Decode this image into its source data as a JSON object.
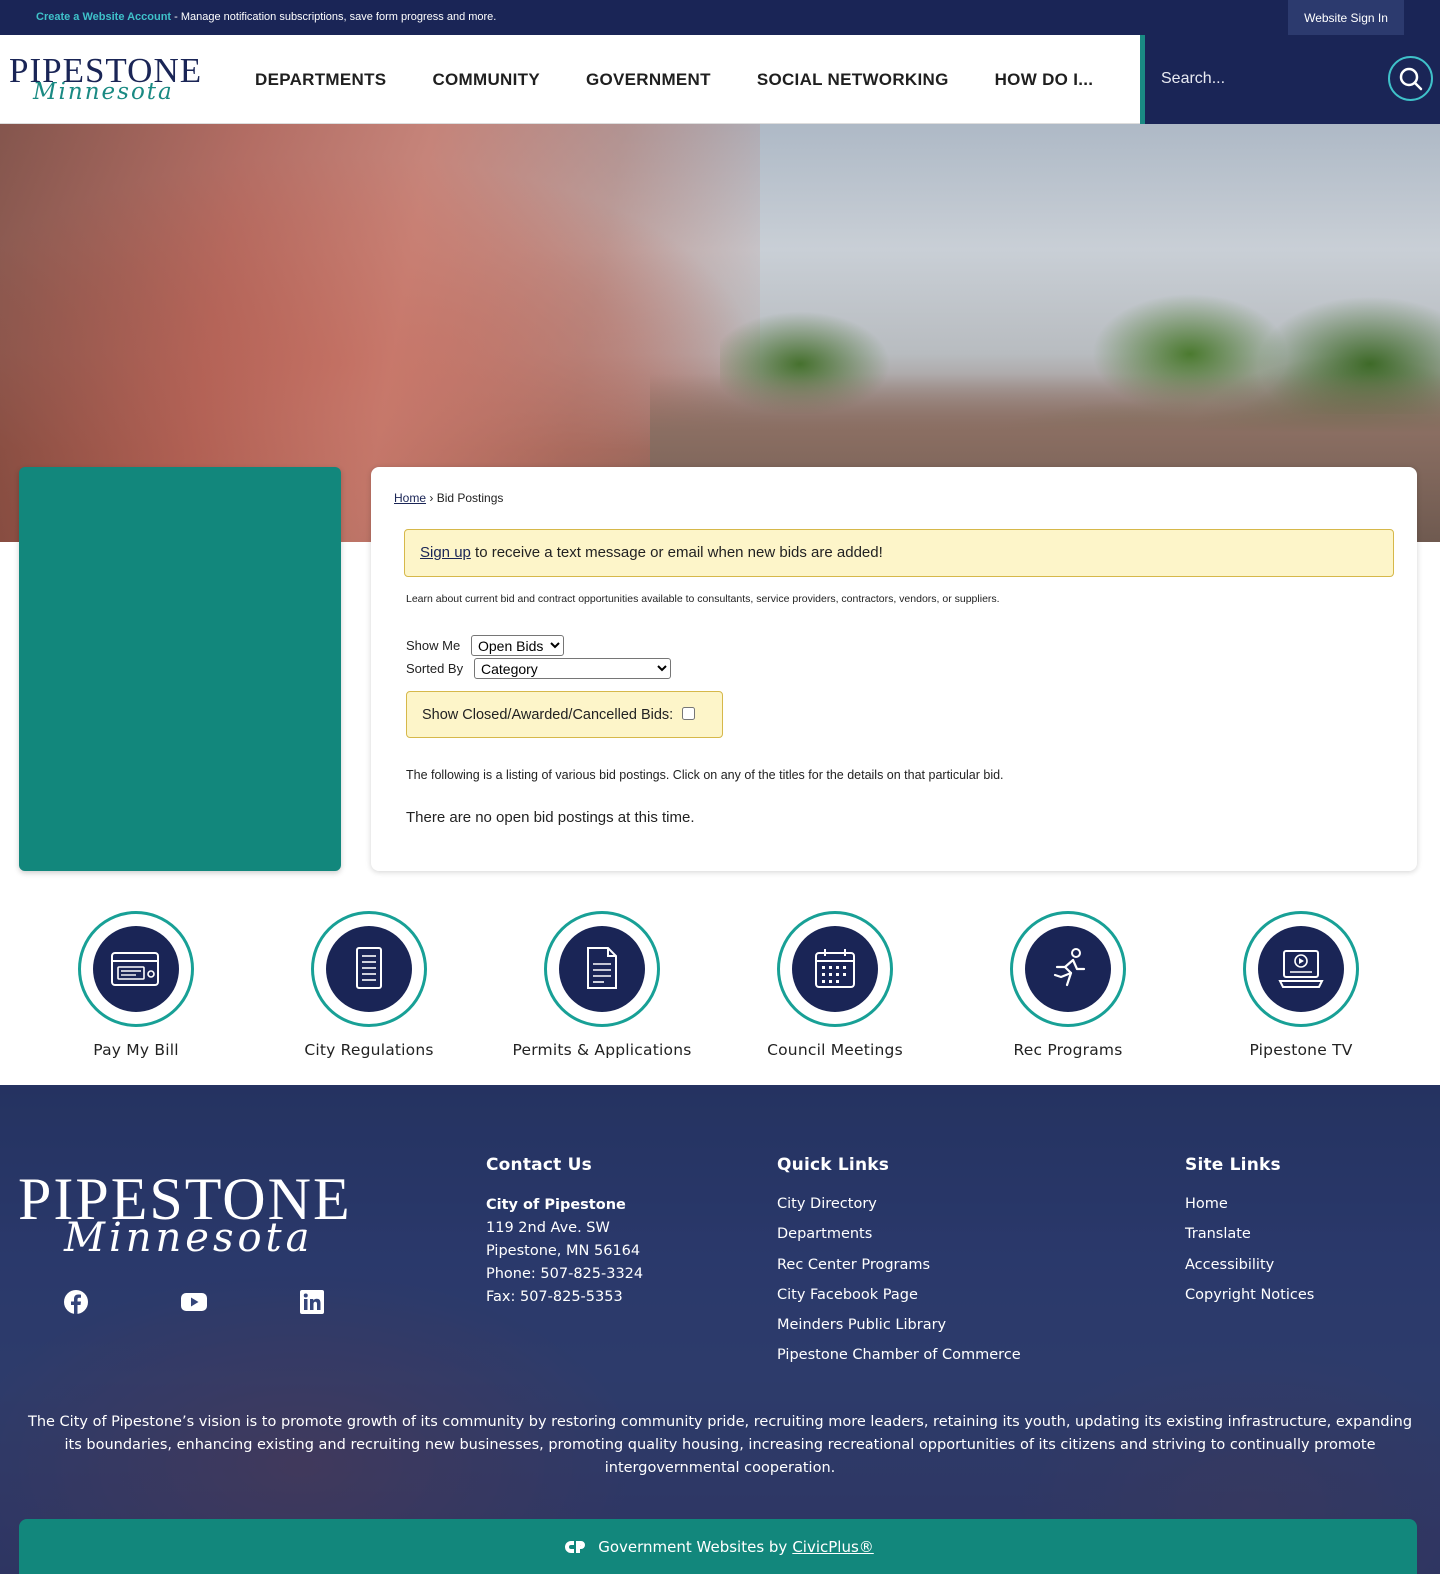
{
  "topbar": {
    "create_account": "Create a Website Account",
    "create_account_desc": " - Manage notification subscriptions, save form progress and more.",
    "sign_in": "Website Sign In"
  },
  "header": {
    "logo_main": "PIPESTONE",
    "logo_script": "Minnesota",
    "nav": [
      "DEPARTMENTS",
      "COMMUNITY",
      "GOVERNMENT",
      "SOCIAL NETWORKING",
      "HOW DO I..."
    ],
    "search_placeholder": "Search..."
  },
  "breadcrumb": {
    "home": "Home",
    "sep": " › ",
    "current": "Bid Postings"
  },
  "alert": {
    "link": "Sign up",
    "text": " to receive a text message or email when new bids are added!"
  },
  "description": "Learn about current bid and contract opportunities available to consultants, service providers, contractors, vendors, or suppliers.",
  "filters": {
    "show_me_label": "Show Me",
    "show_me_value": "Open Bids",
    "sorted_by_label": "Sorted By",
    "sorted_by_value": "Category",
    "closed_label": "Show Closed/Awarded/Cancelled Bids:"
  },
  "listing_text": "The following is a listing of various bid postings. Click on any of the titles for the details on that particular bid.",
  "no_bids": "There are no open bid postings at this time.",
  "quick_links": [
    {
      "label": "Pay My Bill",
      "icon": "credit-card-icon"
    },
    {
      "label": "City Regulations",
      "icon": "document-scroll-icon"
    },
    {
      "label": "Permits & Applications",
      "icon": "file-pages-icon"
    },
    {
      "label": "Council Meetings",
      "icon": "calendar-icon"
    },
    {
      "label": "Rec Programs",
      "icon": "runner-icon"
    },
    {
      "label": "Pipestone TV",
      "icon": "video-monitor-icon"
    }
  ],
  "footer": {
    "logo_main": "PIPESTONE",
    "logo_script": "Minnesota",
    "social": [
      "facebook-icon",
      "youtube-icon",
      "linkedin-icon"
    ],
    "contact": {
      "title": "Contact Us",
      "org": "City of Pipestone",
      "address1": "119 2nd Ave. SW",
      "address2": "Pipestone, MN  56164",
      "phone": "Phone: 507-825-3324",
      "fax": "Fax:  507-825-5353"
    },
    "quick_links": {
      "title": "Quick Links",
      "items": [
        "City Directory",
        "Departments",
        "Rec Center Programs",
        "City Facebook Page",
        "Meinders Public Library",
        "Pipestone Chamber of Commerce"
      ]
    },
    "site_links": {
      "title": "Site Links",
      "items": [
        "Home",
        "Translate",
        "Accessibility",
        "Copyright Notices"
      ]
    },
    "vision": "The City of Pipestone’s vision is to promote growth of its community by restoring community pride, recruiting more leaders, retaining its youth, updating its existing infrastructure, expanding its boundaries, enhancing existing and recruiting new businesses, promoting quality housing, increasing recreational opportunities of its citizens and striving to continually promote intergovernmental cooperation.",
    "civic_text": "Government Websites by",
    "civic_link": "CivicPlus®"
  },
  "colors": {
    "navy": "#1a2556",
    "teal": "#12877c",
    "accent": "#3fc1c9",
    "alert_bg": "#fdf5c9"
  }
}
